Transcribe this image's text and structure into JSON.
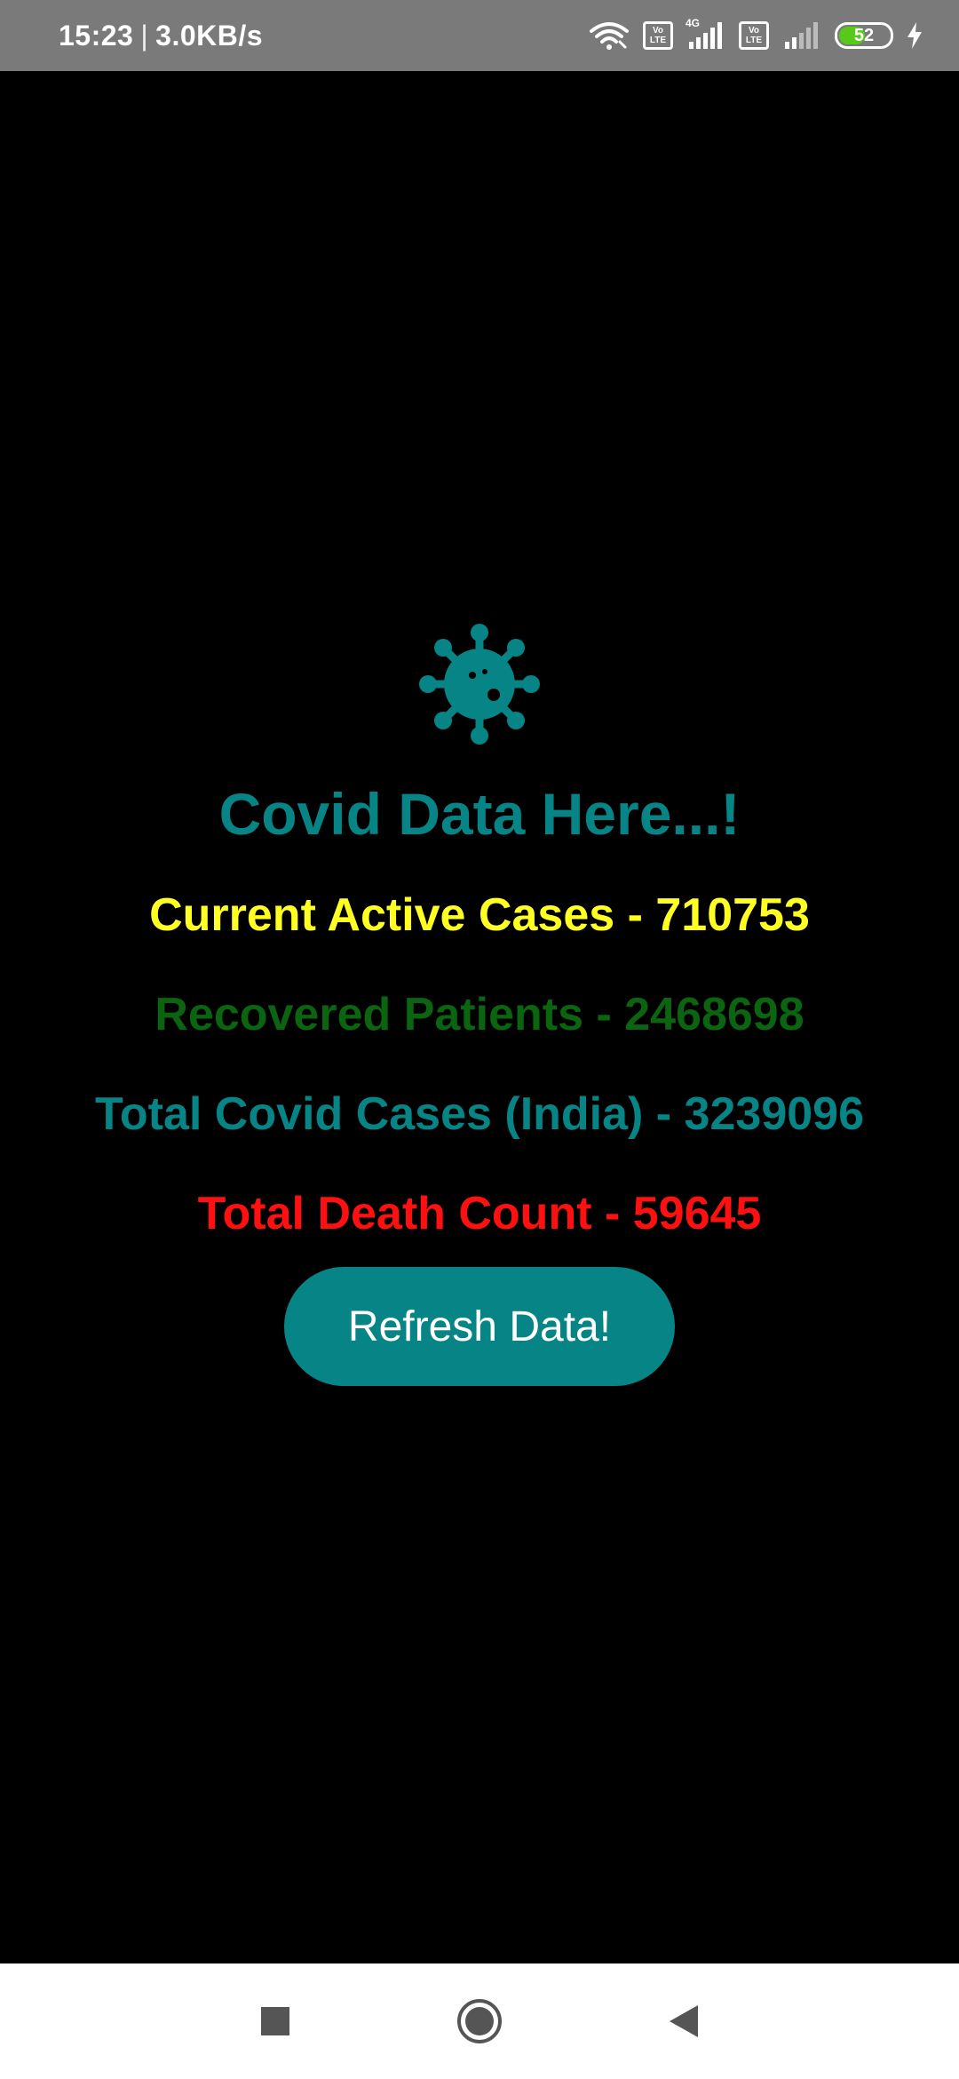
{
  "status_bar": {
    "time": "15:23",
    "separator": "|",
    "network_speed": "3.0KB/s",
    "sim1_label_top": "Vo",
    "sim1_label_bottom": "LTE",
    "network_type": "4G",
    "sim2_label_top": "Vo",
    "sim2_label_bottom": "LTE",
    "battery_level": "52",
    "battery_fraction": 0.52,
    "icons": [
      "wifi-icon",
      "volte-icon",
      "signal-icon",
      "volte-icon",
      "signal-icon",
      "battery-icon",
      "charging-icon"
    ]
  },
  "main": {
    "icon": "virus-icon",
    "title": "Covid Data Here...!",
    "active_cases": "Current Active Cases - 710753",
    "recovered": "Recovered Patients - 2468698",
    "total_cases": "Total Covid Cases (India) - 3239096",
    "deaths": "Total Death Count - 59645",
    "refresh_label": "Refresh Data!"
  },
  "colors": {
    "teal": "#068486",
    "yellow": "#ffff22",
    "green": "#0a6410",
    "red": "#ff1010",
    "background": "#000000"
  },
  "nav_bar": {
    "icons": [
      "recents-square-icon",
      "home-circle-icon",
      "back-triangle-icon"
    ]
  }
}
